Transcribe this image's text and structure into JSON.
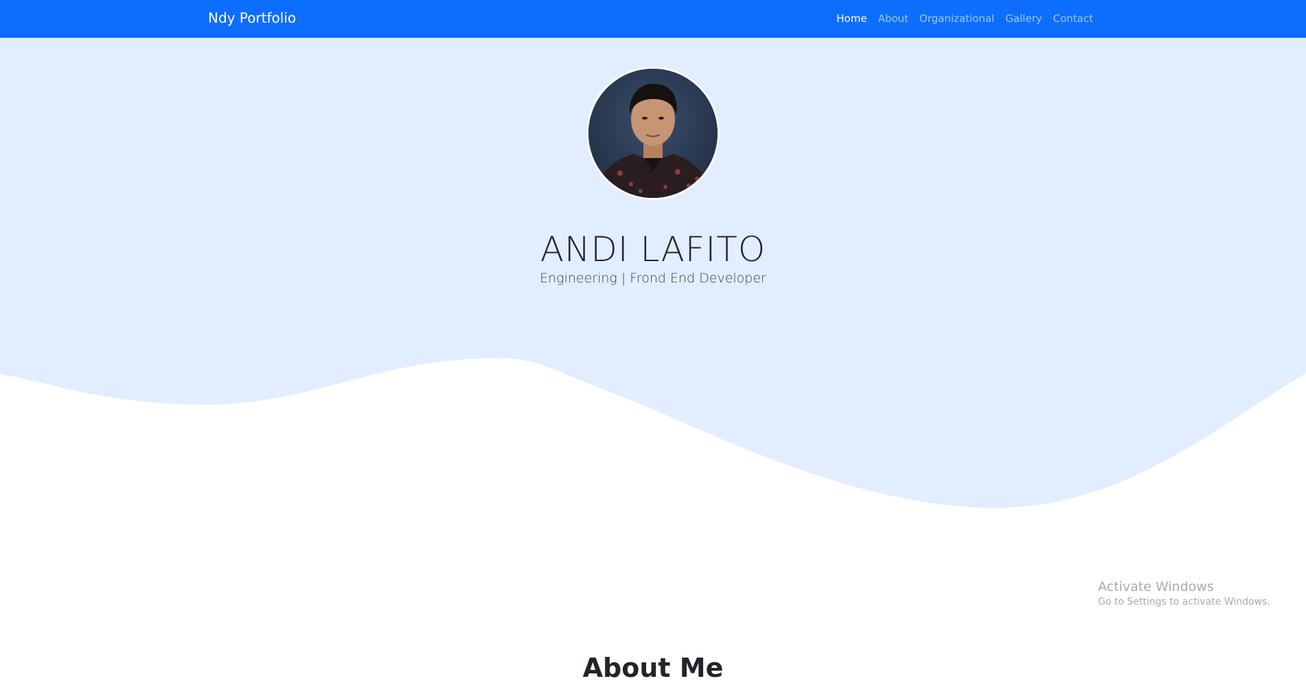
{
  "navbar": {
    "brand": "Ndy Portfolio",
    "links": [
      {
        "label": "Home",
        "active": true
      },
      {
        "label": "About",
        "active": false
      },
      {
        "label": "Organizational",
        "active": false
      },
      {
        "label": "Gallery",
        "active": false
      },
      {
        "label": "Contact",
        "active": false
      }
    ]
  },
  "hero": {
    "name": "ANDI LAFITO",
    "subtitle": "Engineering | Frond End Developer"
  },
  "about": {
    "heading": "About Me"
  },
  "watermark": {
    "title": "Activate Windows",
    "subtitle": "Go to Settings to activate Windows."
  },
  "colors": {
    "primary": "#0d6efd",
    "hero_background": "#e2edff",
    "text": "#212529"
  }
}
